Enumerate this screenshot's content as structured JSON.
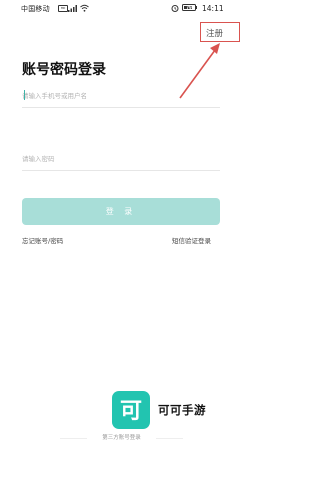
{
  "status_bar": {
    "carrier": "中国移动",
    "hd_badge": "HD",
    "time": "14:11",
    "battery_label": "79",
    "battery_level": 0.79
  },
  "header": {
    "register_label": "注册"
  },
  "login": {
    "title": "账号密码登录",
    "account_placeholder": "请输入手机号或用户名",
    "password_placeholder": "请输入密码",
    "login_button": "登 录",
    "forgot_link": "忘记账号/密码",
    "sms_link": "短信验证登录"
  },
  "footer": {
    "logo_char": "可",
    "brand_name": "可可手游",
    "third_party_label": "第三方账号登录"
  },
  "annotation": {
    "color": "#d9534f"
  },
  "colors": {
    "accent": "#22c4b0",
    "button_disabled": "#a8ded8"
  }
}
